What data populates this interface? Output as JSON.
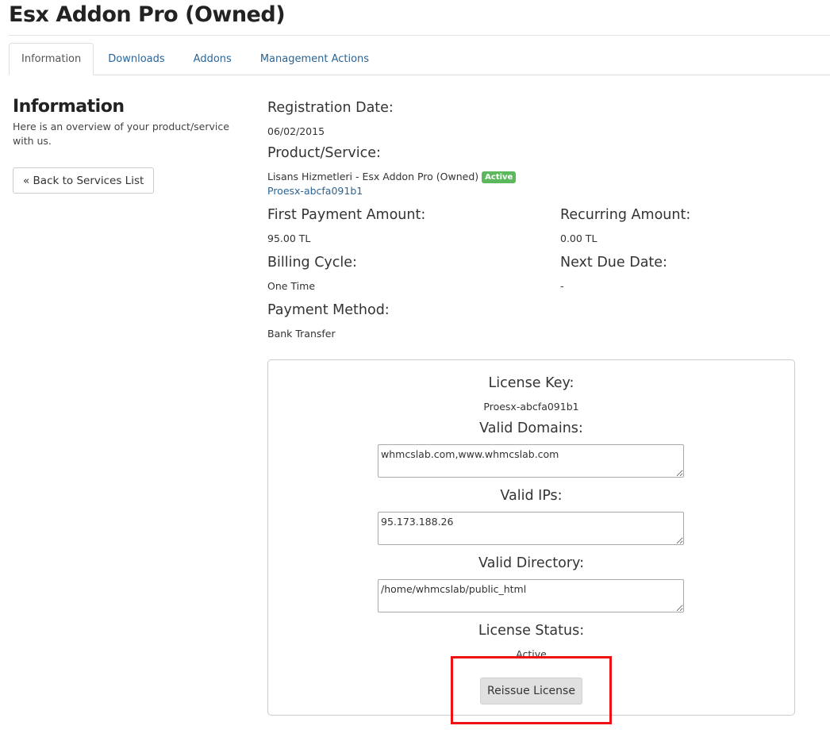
{
  "page": {
    "title": "Esx Addon Pro (Owned)"
  },
  "tabs": [
    {
      "label": "Information",
      "active": true
    },
    {
      "label": "Downloads",
      "active": false
    },
    {
      "label": "Addons",
      "active": false
    },
    {
      "label": "Management Actions",
      "active": false
    }
  ],
  "sidebar": {
    "title": "Information",
    "description": "Here is an overview of your product/service with us.",
    "back_label": "« Back to Services List"
  },
  "details": {
    "registration_date": {
      "label": "Registration Date:",
      "value": "06/02/2015"
    },
    "product_service": {
      "label": "Product/Service:",
      "value": "Lisans Hizmetleri - Esx Addon Pro (Owned)",
      "status_badge": "Active",
      "link": "Proesx-abcfa091b1"
    },
    "first_payment": {
      "label": "First Payment Amount:",
      "value": "95.00 TL"
    },
    "recurring": {
      "label": "Recurring Amount:",
      "value": "0.00 TL"
    },
    "billing_cycle": {
      "label": "Billing Cycle:",
      "value": "One Time"
    },
    "next_due": {
      "label": "Next Due Date:",
      "value": "-"
    },
    "payment_method": {
      "label": "Payment Method:",
      "value": "Bank Transfer"
    }
  },
  "license": {
    "key_label": "License Key:",
    "key_value": "Proesx-abcfa091b1",
    "domains_label": "Valid Domains:",
    "domains_value": "whmcslab.com,www.whmcslab.com",
    "ips_label": "Valid IPs:",
    "ips_value": "95.173.188.26",
    "directory_label": "Valid Directory:",
    "directory_value": "/home/whmcslab/public_html",
    "status_label": "License Status:",
    "status_value": "Active",
    "reissue_label": "Reissue License"
  },
  "colors": {
    "link": "#2a6496",
    "badge": "#5cb85c",
    "highlight": "#ee1111"
  }
}
